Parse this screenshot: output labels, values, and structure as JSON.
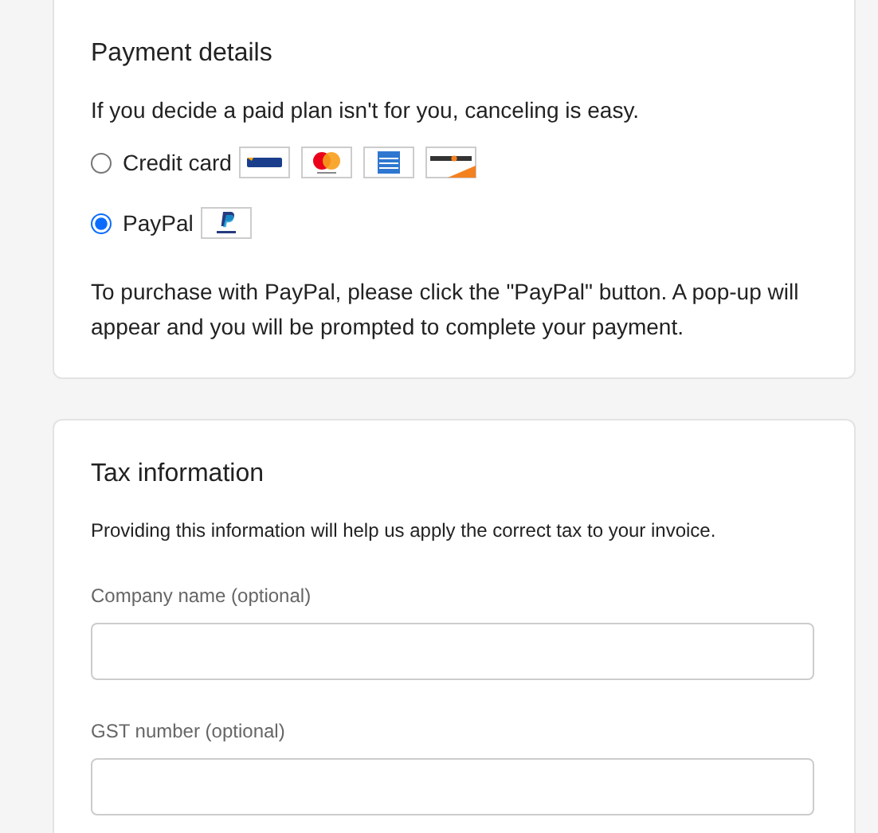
{
  "payment": {
    "title": "Payment details",
    "intro": "If you decide a paid plan isn't for you, canceling is easy.",
    "options": [
      {
        "label": "Credit card",
        "selected": false,
        "logos": [
          {
            "kind": "visa"
          },
          {
            "kind": "mastercard"
          },
          {
            "kind": "amex"
          },
          {
            "kind": "discover"
          }
        ]
      },
      {
        "label": "PayPal",
        "selected": true,
        "logos": [
          {
            "kind": "paypal"
          }
        ]
      }
    ],
    "note": "To purchase with PayPal, please click the \"PayPal\" button. A pop-up will appear and you will be prompted to complete your payment."
  },
  "tax": {
    "title": "Tax information",
    "intro": "Providing this information will help us apply the correct tax to your invoice.",
    "fields": [
      {
        "label": "Company name (optional)"
      },
      {
        "label": "GST number (optional)"
      }
    ]
  }
}
